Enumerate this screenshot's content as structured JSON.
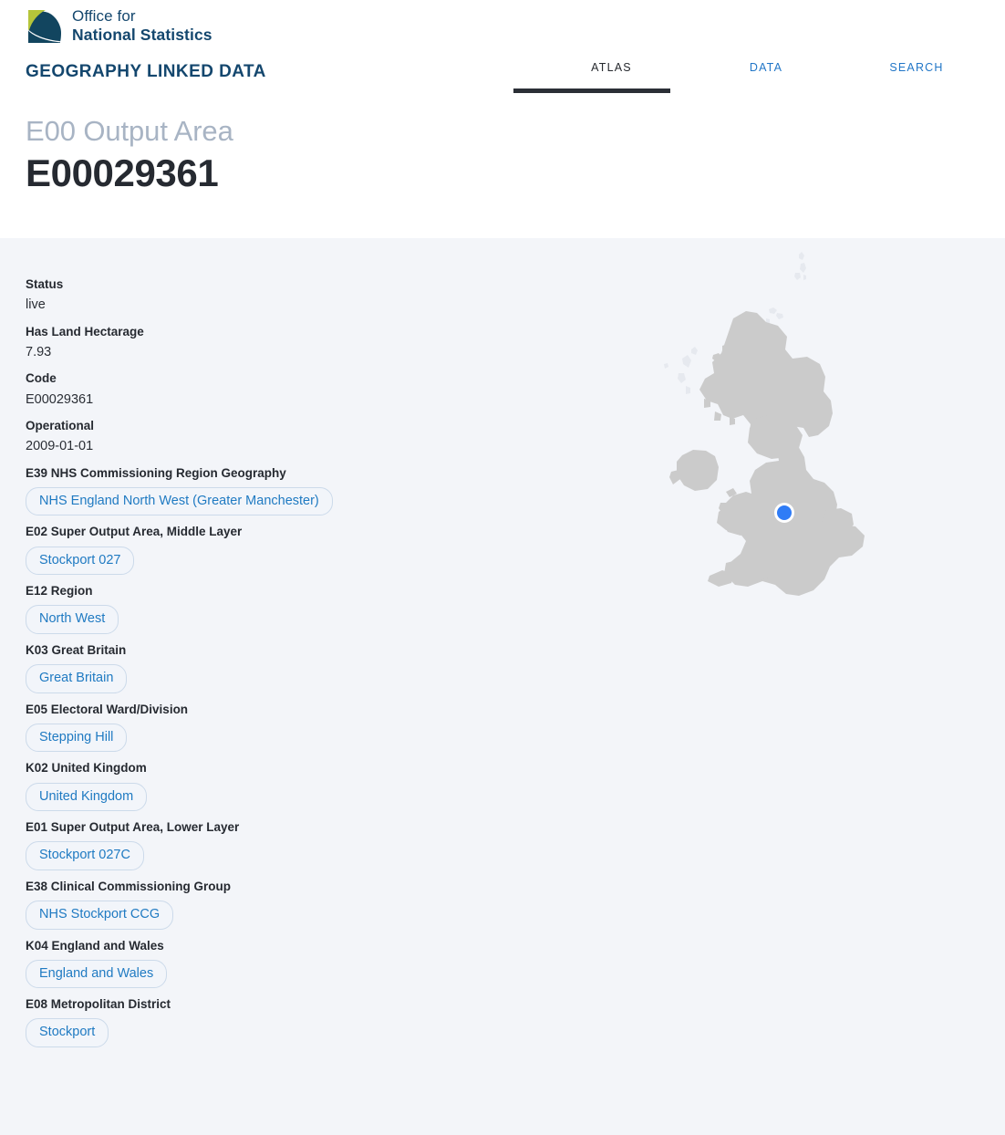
{
  "brand": {
    "logo_icon": "ons-logo-icon",
    "line1": "Office for",
    "line2": "National Statistics"
  },
  "site_title": "GEOGRAPHY LINKED DATA",
  "nav": {
    "items": [
      {
        "label": "ATLAS",
        "active": true
      },
      {
        "label": "DATA",
        "active": false
      },
      {
        "label": "SEARCH",
        "active": false
      }
    ]
  },
  "heading": {
    "kind": "E00 Output Area",
    "code": "E00029361"
  },
  "properties": [
    {
      "label": "Status",
      "value": "live",
      "type": "text"
    },
    {
      "label": "Has Land Hectarage",
      "value": "7.93",
      "type": "text"
    },
    {
      "label": "Code",
      "value": "E00029361",
      "type": "text"
    },
    {
      "label": "Operational",
      "value": "2009-01-01",
      "type": "text"
    },
    {
      "label": "E39 NHS Commissioning Region Geography",
      "value": "NHS England North West (Greater Manchester)",
      "type": "pill"
    },
    {
      "label": "E02 Super Output Area, Middle Layer",
      "value": "Stockport 027",
      "type": "pill"
    },
    {
      "label": "E12 Region",
      "value": "North West",
      "type": "pill"
    },
    {
      "label": "K03 Great Britain",
      "value": "Great Britain",
      "type": "pill"
    },
    {
      "label": "E05 Electoral Ward/Division",
      "value": "Stepping Hill",
      "type": "pill"
    },
    {
      "label": "K02 United Kingdom",
      "value": "United Kingdom",
      "type": "pill"
    },
    {
      "label": "E01 Super Output Area, Lower Layer",
      "value": "Stockport 027C",
      "type": "pill"
    },
    {
      "label": "E38 Clinical Commissioning Group",
      "value": "NHS Stockport CCG",
      "type": "pill"
    },
    {
      "label": "K04 England and Wales",
      "value": "England and Wales",
      "type": "pill"
    },
    {
      "label": "E08 Metropolitan District",
      "value": "Stockport",
      "type": "pill"
    }
  ],
  "map": {
    "name": "uk-locator-map",
    "marker_label": "E00029361 location marker",
    "land_color": "#cbcbcb",
    "marker_color": "#2f7cf6",
    "background_color": "#f3f5f9"
  },
  "colors": {
    "brand_navy": "#14476e",
    "link_blue": "#2176c7",
    "pill_blue": "#1f7ac2",
    "heading_grey": "#a8b4c4",
    "page_bg": "#f3f5f9"
  }
}
